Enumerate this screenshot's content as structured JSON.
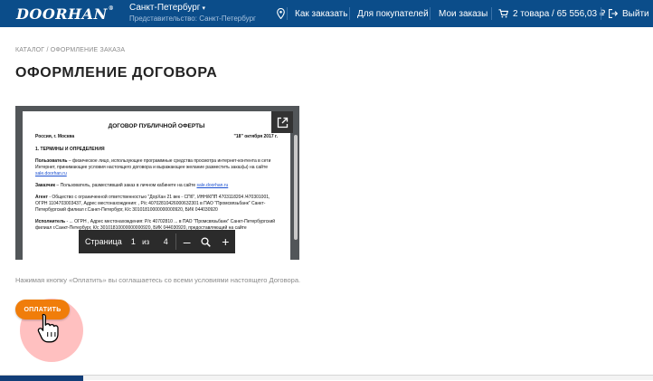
{
  "header": {
    "logo": "DOORHAN",
    "logo_mark": "®",
    "city": "Санкт-Петербург",
    "office": "Представительство: Санкт-Петербург",
    "nav": {
      "how_to_order": "Как заказать",
      "for_buyers": "Для покупателей",
      "my_orders": "Мои заказы",
      "cart": "2 товара / 65 556,03 ₽",
      "logout": "Выйти"
    }
  },
  "breadcrumb": "КАТАЛОГ / ОФОРМЛЕНИЕ ЗАКАЗА",
  "page_title": "ОФОРМЛЕНИЕ ДОГОВОРА",
  "document": {
    "title": "ДОГОВОР ПУБЛИЧНОЙ ОФЕРТЫ",
    "place": "Россия, г. Москва",
    "date": "\"18\" октября 2017 г.",
    "section1": "1. ТЕРМИНЫ И ОПРЕДЕЛЕНИЯ",
    "user_term": "Пользователь",
    "user_def": " – физическое лицо, использующее программные средства просмотра интернет-контента в сети Интернет, принимающее условия настоящего договора и выражающее желание разместить заказ(ы) на сайте ",
    "user_link": "sale.doorhan.ru",
    "customer_term": "Заказчик",
    "customer_def": " – Пользователь, разместивший заказ в личном кабинете на сайте ",
    "customer_link": "sale.doorhan.ru",
    "agent_term": "Агент",
    "agent_def": " - Общество с ограниченной ответственностью \"ДорХан 21 век - СПб\", ИНН/КПП 4703118204 /470301001, ОГРН 1104703003437, Адрес местонахождения: , Р/с 40702810426000632301 в ПАО \"Промсвязьбанк\" Санкт-Петербургский филиал г.Санкт-Петербург, К/с 30101810000000000920, БИК 044030920",
    "executor_term": "Исполнитель",
    "executor_def": " - ... ОГРН , Адрес местонахождения: Р/с 40702810 ... в ПАО \"Промсвязьбанк\" Санкт-Петербургский филиал г.Санкт-Петербург, К/с 30101810000000000920, БИК 044030920, предоставляющий на сайте"
  },
  "pdf_toolbar": {
    "page_label": "Страница",
    "page_current": "1",
    "of_label": "из",
    "page_total": "4",
    "zoom_out": "–",
    "zoom_in": "+"
  },
  "agreement_note": "Нажимая кнопку «Оплатить» вы соглашаетесь со всеми условиями настоящего Договора.",
  "pay_button": "ОПЛАТИТЬ",
  "colors": {
    "header_bg": "#0b4d8a",
    "accent": "#f07d0a",
    "link": "#1a4fd0"
  },
  "icons": [
    "chevron-down-icon",
    "map-pin-icon",
    "cart-icon",
    "logout-icon",
    "open-external-icon",
    "zoom-icon",
    "hand-pointer-icon"
  ]
}
